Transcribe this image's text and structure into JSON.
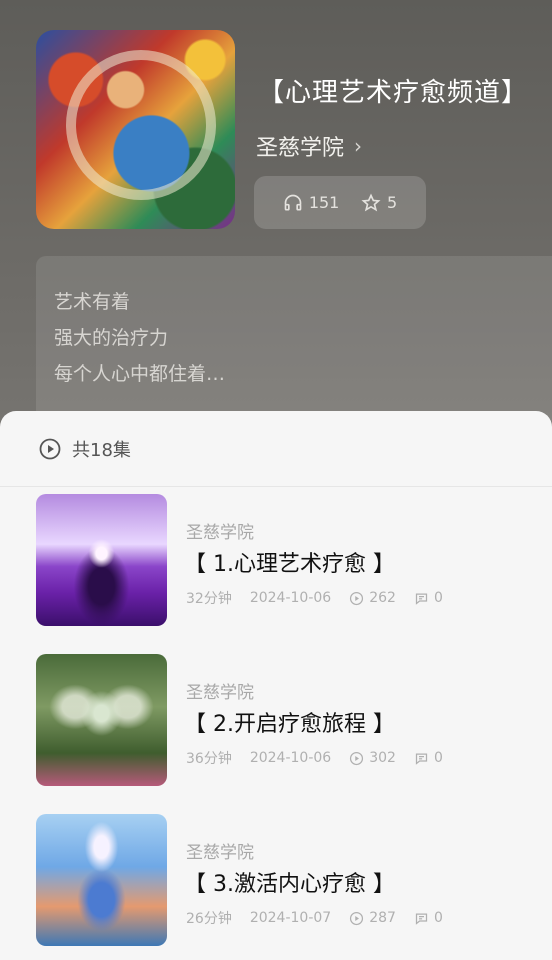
{
  "channel": {
    "title": "【心理艺术疗愈频道】",
    "author": "圣慈学院",
    "listens": "151",
    "favorites": "5",
    "description": [
      "艺术有着",
      "强大的治疗力",
      "每个人心中都住着…"
    ]
  },
  "sheet": {
    "episode_count": "共18集",
    "episodes": [
      {
        "source": "圣慈学院",
        "title": "【 1.心理艺术疗愈 】",
        "duration": "32分钟",
        "date": "2024-10-06",
        "plays": "262",
        "comments": "0"
      },
      {
        "source": "圣慈学院",
        "title": "【 2.开启疗愈旅程 】",
        "duration": "36分钟",
        "date": "2024-10-06",
        "plays": "302",
        "comments": "0"
      },
      {
        "source": "圣慈学院",
        "title": "【 3.激活内心疗愈 】",
        "duration": "26分钟",
        "date": "2024-10-07",
        "plays": "287",
        "comments": "0"
      }
    ]
  },
  "icons": {
    "listens": "headphones-icon",
    "favorites": "star-icon",
    "author_link": "chevron-right-icon",
    "episode_count": "play-circle-icon",
    "plays": "play-circle-icon",
    "comments": "comment-icon"
  }
}
